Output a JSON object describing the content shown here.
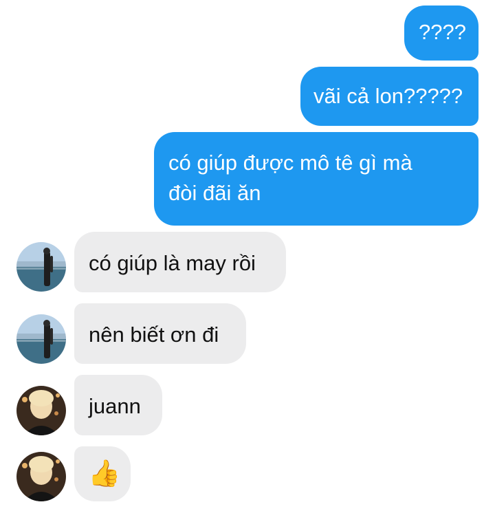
{
  "conversation": {
    "outgoing": [
      {
        "text": "????"
      },
      {
        "text": "vãi cả lon?????"
      },
      {
        "line1": "có giúp được mô tê gì mà",
        "line2": "đòi đãi ăn"
      }
    ],
    "incoming": [
      {
        "text": "có giúp là may rồi",
        "avatar": "lake-photo-avatar"
      },
      {
        "text": "nên biết ơn đi",
        "avatar": "lake-photo-avatar"
      },
      {
        "text": "juann",
        "avatar": "blonde-person-avatar"
      },
      {
        "text": "👍",
        "avatar": "blonde-person-avatar",
        "icon": "thumbs-up-icon"
      }
    ]
  },
  "colors": {
    "outgoing_bubble": "#1e98f0",
    "incoming_bubble": "#ececed",
    "outgoing_text": "#ffffff",
    "incoming_text": "#111111"
  }
}
